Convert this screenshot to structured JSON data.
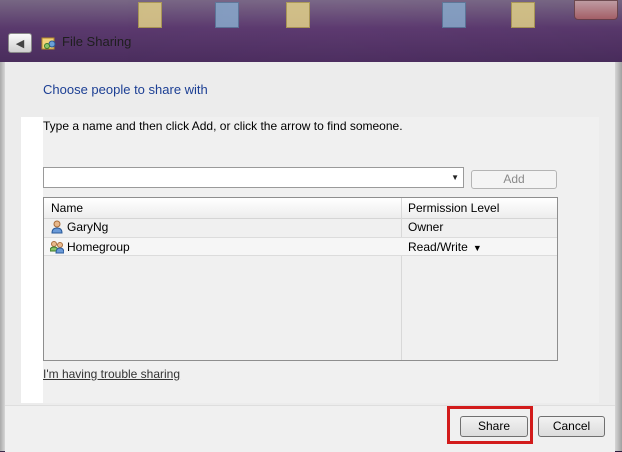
{
  "window": {
    "title": "File Sharing",
    "icons": {
      "back": "back-arrow-icon",
      "app": "file-sharing-icon"
    }
  },
  "dialog": {
    "heading": "Choose people to share with",
    "instructions": "Type a name and then click Add, or click the arrow to find someone.",
    "name_input": {
      "value": "",
      "placeholder": ""
    },
    "add_label": "Add",
    "columns": {
      "name": "Name",
      "permission": "Permission Level"
    },
    "rows": [
      {
        "name": "GaryNg",
        "permission": "Owner",
        "icon": "user-icon"
      },
      {
        "name": "Homegroup",
        "permission": "Read/Write",
        "icon": "homegroup-icon",
        "has_dropdown": true
      }
    ],
    "trouble_link": "I'm having trouble sharing",
    "share_label": "Share",
    "cancel_label": "Cancel",
    "highlight_color": "#d21b1b"
  }
}
